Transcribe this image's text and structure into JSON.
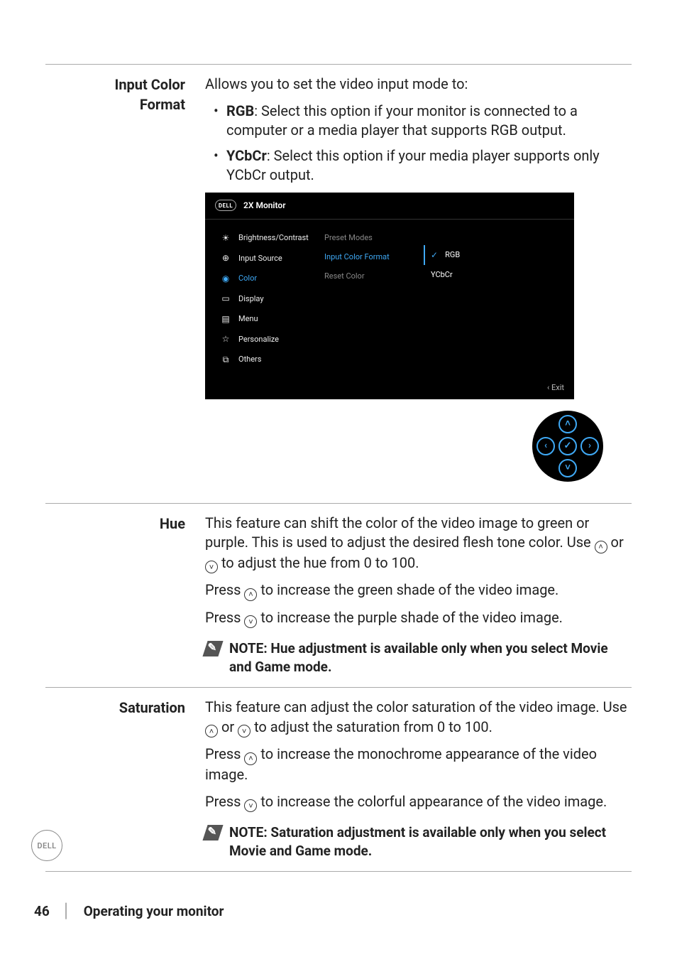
{
  "sections": {
    "inputColorFormat": {
      "label_l1": "Input Color",
      "label_l2": "Format",
      "intro": "Allows you to set the video input mode to:",
      "rgb_bold": "RGB",
      "rgb_text": ": Select this option if your monitor is connected to a computer or a media player that supports RGB output.",
      "ycbcr_bold": "YCbCr",
      "ycbcr_text": ": Select this option if your media player supports only YCbCr output."
    },
    "hue": {
      "label": "Hue",
      "p1a": "This feature can shift the color of the video image to green or purple. This is used to adjust the desired flesh tone color. Use ",
      "p1b": " or ",
      "p1c": " to adjust the hue from 0 to 100.",
      "p2a": "Press ",
      "p2b": " to increase the green shade of the video image.",
      "p3a": "Press ",
      "p3b": " to increase the purple shade of the video image.",
      "note": "NOTE: Hue adjustment is available only when you select Movie and Game mode."
    },
    "saturation": {
      "label": "Saturation",
      "p1a": "This feature can adjust the color saturation of the video image. Use ",
      "p1b": " or ",
      "p1c": " to adjust the saturation from 0 to 100.",
      "p2a": "Press ",
      "p2b": " to increase the monochrome appearance of the video image.",
      "p3a": "Press ",
      "p3b": " to increase the colorful appearance of the video image.",
      "note": "NOTE: Saturation adjustment is available only when you select Movie and Game mode."
    }
  },
  "osd": {
    "logo": "DELL",
    "title": "2X Monitor",
    "menu": [
      {
        "icon": "☀",
        "label": "Brightness/Contrast",
        "accent": false
      },
      {
        "icon": "⊕",
        "label": "Input Source",
        "accent": false
      },
      {
        "icon": "◉",
        "label": "Color",
        "accent": true
      },
      {
        "icon": "▭",
        "label": "Display",
        "accent": false
      },
      {
        "icon": "▤",
        "label": "Menu",
        "accent": false
      },
      {
        "icon": "☆",
        "label": "Personalize",
        "accent": false
      },
      {
        "icon": "⧉",
        "label": "Others",
        "accent": false
      }
    ],
    "submenu": [
      {
        "label": "Preset Modes",
        "dim": true
      },
      {
        "label": "Input Color Format",
        "accent": true
      },
      {
        "label": "Reset Color",
        "dim": true
      }
    ],
    "options": [
      {
        "label": "RGB",
        "selected": true
      },
      {
        "label": "YCbCr",
        "selected": false
      }
    ],
    "exit": "Exit",
    "exit_prefix": "‹"
  },
  "nav_glyphs": {
    "up": "˄",
    "down": "˅",
    "left": "‹",
    "right": "›",
    "ok": "✓"
  },
  "footer": {
    "page": "46",
    "sep": "│",
    "chapter": "Operating your monitor",
    "badge": "DELL"
  },
  "chart_data": null
}
